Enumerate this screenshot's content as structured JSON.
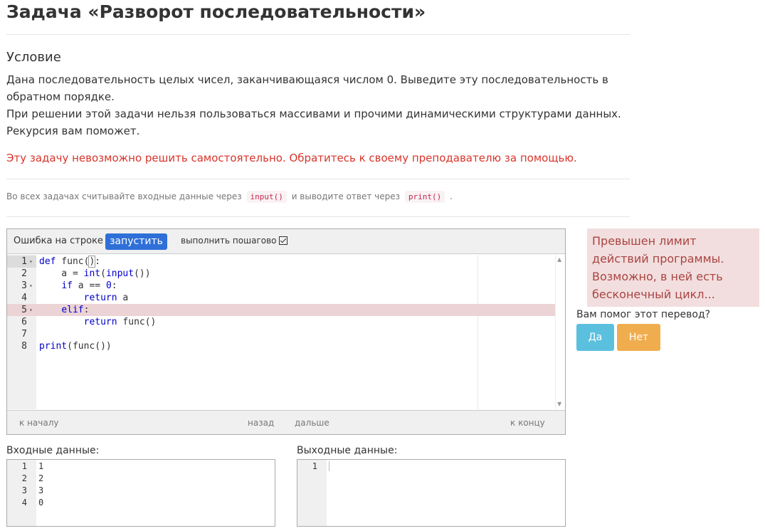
{
  "title": "Задача «Разворот последовательности»",
  "condition": {
    "heading": "Условие",
    "paragraph1": "Дана последовательность целых чисел, заканчивающаяся числом 0. Выведите эту последовательность в обратном порядке.",
    "paragraph2": "При решении этой задачи нельзя пользоваться массивами и прочими динамическими структурами данных. Рекурсия вам поможет.",
    "warning": "Эту задачу невозможно решить самостоятельно. Обратитесь к своему преподавателю за помощью."
  },
  "hint": {
    "before": "Во всех задачах считывайте входные данные через",
    "code1": "input()",
    "middle": "и выводите ответ через",
    "code2": "print()",
    "after": "."
  },
  "toolbar": {
    "error_label": "Ошибка на строке 5",
    "run_label": "запустить",
    "step_label": "выполнить пошагово",
    "step_checked": true
  },
  "code": {
    "lines": [
      {
        "n": "1",
        "text": "def func():"
      },
      {
        "n": "2",
        "text": "    a = int(input())"
      },
      {
        "n": "3",
        "text": "    if a == 0:"
      },
      {
        "n": "4",
        "text": "        return a"
      },
      {
        "n": "5",
        "text": "    elif:"
      },
      {
        "n": "6",
        "text": "        return func()"
      },
      {
        "n": "7",
        "text": ""
      },
      {
        "n": "8",
        "text": "print(func())"
      }
    ],
    "error_line": 5
  },
  "nav": {
    "start": "к началу",
    "back": "назад",
    "forward": "дальше",
    "end": "к концу"
  },
  "alert": {
    "text": "Превышен лимит действий программы. Возможно, в ней есть бесконечный цикл..."
  },
  "feedback": {
    "question": "Вам помог этот перевод?",
    "yes": "Да",
    "no": "Нет"
  },
  "input_panel": {
    "label": "Входные данные:",
    "lines": [
      {
        "n": "1",
        "text": "1"
      },
      {
        "n": "2",
        "text": "2"
      },
      {
        "n": "3",
        "text": "3"
      },
      {
        "n": "4",
        "text": "0"
      }
    ]
  },
  "output_panel": {
    "label": "Выходные данные:",
    "lines": [
      {
        "n": "1",
        "text": ""
      }
    ]
  },
  "colors": {
    "run_button": "#2f6fd8",
    "error_highlight": "#ecd3d5",
    "alert_bg": "#f2dede",
    "alert_text": "#a94442",
    "warning_text": "#d9342b",
    "yes_button": "#5bc0de",
    "no_button": "#f0ad4e"
  }
}
